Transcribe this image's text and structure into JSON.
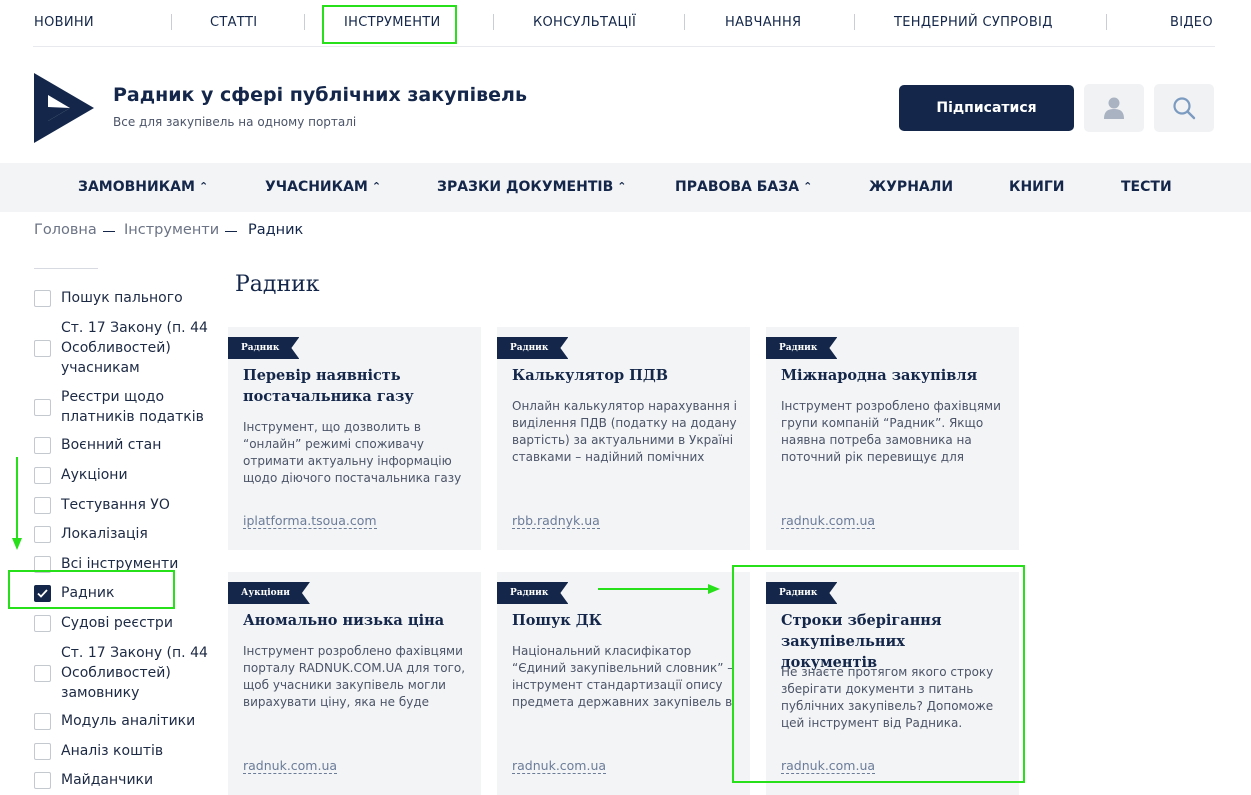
{
  "top_nav": [
    "НОВИНИ",
    "СТАТТІ",
    "ІНСТРУМЕНТИ",
    "КОНСУЛЬТАЦІЇ",
    "НАВЧАННЯ",
    "ТЕНДЕРНИЙ СУПРОВІД",
    "ВІДЕО"
  ],
  "header": {
    "title": "Радник у сфері публічних закупівель",
    "subtitle": "Все для закупівель на одному порталі",
    "subscribe": "Підписатися",
    "user_icon": "user-icon",
    "search_icon": "search-icon"
  },
  "main_nav": [
    {
      "label": "ЗАМОВНИКАМ",
      "chevron": "⌃"
    },
    {
      "label": "УЧАСНИКАМ",
      "chevron": "⌃"
    },
    {
      "label": "ЗРАЗКИ ДОКУМЕНТІВ",
      "chevron": "⌃"
    },
    {
      "label": "ПРАВОВА БАЗА",
      "chevron": "⌃"
    },
    {
      "label": "ЖУРНАЛИ",
      "chevron": ""
    },
    {
      "label": "КНИГИ",
      "chevron": ""
    },
    {
      "label": "ТЕСТИ",
      "chevron": ""
    }
  ],
  "breadcrumb": [
    "Головна",
    "Інструменти",
    "Радник"
  ],
  "filters": [
    {
      "label": "Пошук пального",
      "checked": false
    },
    {
      "label": "Ст. 17 Закону (п. 44 Особливостей) учасникам",
      "checked": false
    },
    {
      "label": "Реєстри щодо платників податків",
      "checked": false
    },
    {
      "label": "Воєнний стан",
      "checked": false
    },
    {
      "label": "Аукціони",
      "checked": false
    },
    {
      "label": "Тестування УО",
      "checked": false
    },
    {
      "label": "Локалізація",
      "checked": false
    },
    {
      "label": "Всі інструменти",
      "checked": false
    },
    {
      "label": "Радник",
      "checked": true
    },
    {
      "label": "Судові реєстри",
      "checked": false
    },
    {
      "label": "Ст. 17 Закону (п. 44 Особливостей) замовнику",
      "checked": false
    },
    {
      "label": "Модуль аналітики",
      "checked": false
    },
    {
      "label": "Аналіз коштів",
      "checked": false
    },
    {
      "label": "Майданчики",
      "checked": false
    }
  ],
  "page_heading": "Радник",
  "cards": [
    {
      "tag": "Радник",
      "title": "Перевір наявність постачальника газу",
      "desc": "Інструмент, що дозволить в “онлайн” режимі споживачу отримати актуальну інформацію щодо діючого постачальника газу",
      "link": "iplatforma.tsoua.com"
    },
    {
      "tag": "Радник",
      "title": "Калькулятор ПДВ",
      "desc": "Онлайн калькулятор нарахування і виділення ПДВ (податку на додану вартість) за актуальними в Україні ставками – надійний помічних",
      "link": "rbb.radnyk.ua"
    },
    {
      "tag": "Радник",
      "title": "Міжнародна закупівля",
      "desc": "Інструмент розроблено фахівцями групи компаній “Радник”. Якщо наявна потреба замовника на поточний рік перевищує для",
      "link": "radnuk.com.ua"
    },
    {
      "tag": "Аукціони",
      "title": "Аномально низька ціна",
      "desc": "Інструмент розроблено фахівцями порталу RADNUK.COM.UA для того, щоб учасники закупівель могли вирахувати ціну, яка не буде",
      "link": "radnuk.com.ua"
    },
    {
      "tag": "Радник",
      "title": "Пошук ДК",
      "desc": "Національний класифікатор “Єдиний закупівельний словник” – інструмент стандартизації опису предмета державних закупівель в",
      "link": "radnuk.com.ua"
    },
    {
      "tag": "Радник",
      "title": "Строки зберігання закупівельних документів",
      "desc": "Не знаєте протягом якого строку зберігати документи з питань публічних закупівель? Допоможе цей інструмент від Радника.",
      "link": "radnuk.com.ua"
    }
  ],
  "colors": {
    "brand": "#14274a",
    "annotation": "#27e01a",
    "panel": "#f3f4f5"
  }
}
